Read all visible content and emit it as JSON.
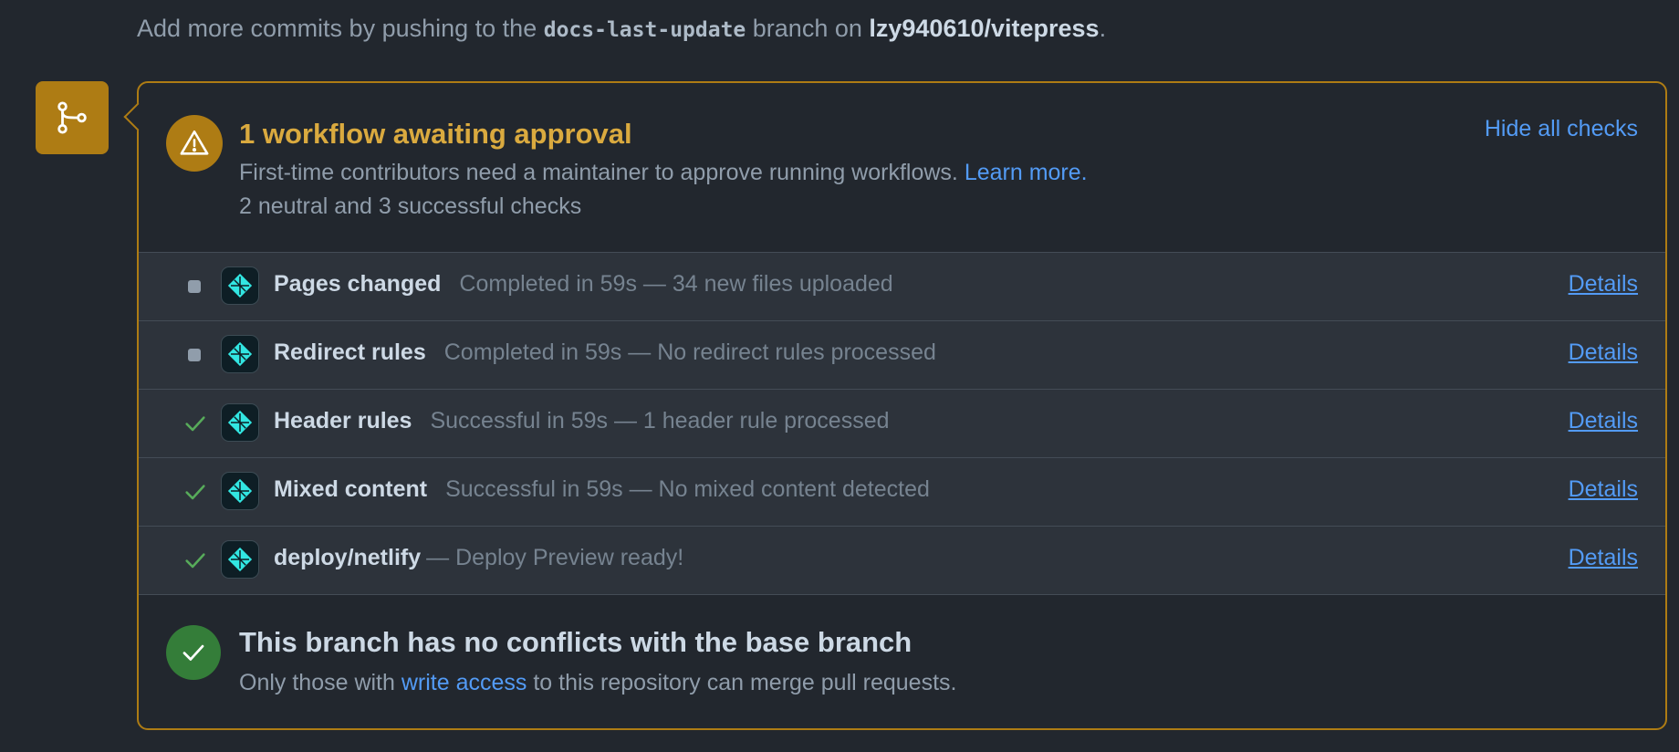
{
  "top": {
    "prefix": "Add more commits by pushing to the ",
    "branch": "docs-last-update",
    "middle": " branch on ",
    "repo": "lzy940610/vitepress",
    "suffix": "."
  },
  "timeline": {
    "icon": "git-branch-icon"
  },
  "approval": {
    "icon": "alert-icon",
    "title": "1 workflow awaiting approval",
    "description": "First-time contributors need a maintainer to approve running workflows. ",
    "learn_more": "Learn more.",
    "summary": "2 neutral and 3 successful checks",
    "hide_checks": "Hide all checks"
  },
  "checks": [
    {
      "status": "neutral",
      "name": "Pages changed",
      "description": "Completed in 59s — 34 new files uploaded",
      "details": "Details"
    },
    {
      "status": "neutral",
      "name": "Redirect rules",
      "description": "Completed in 59s — No redirect rules processed",
      "details": "Details"
    },
    {
      "status": "success",
      "name": "Header rules",
      "description": "Successful in 59s — 1 header rule processed",
      "details": "Details"
    },
    {
      "status": "success",
      "name": "Mixed content",
      "description": "Successful in 59s — No mixed content detected",
      "details": "Details"
    },
    {
      "status": "success",
      "name": "deploy/netlify",
      "description": "— Deploy Preview ready!",
      "details": "Details"
    }
  ],
  "merge": {
    "icon": "check-icon",
    "title": "This branch has no conflicts with the base branch",
    "desc_prefix": "Only those with ",
    "desc_link": "write access",
    "desc_suffix": " to this repository can merge pull requests."
  },
  "colors": {
    "background": "#22272e",
    "attention": "#ae7c14",
    "attention_text": "#daaa3f",
    "link": "#539bf5",
    "success": "#347d39",
    "success_check": "#57ab5a",
    "netlify": "#32e6e2"
  }
}
